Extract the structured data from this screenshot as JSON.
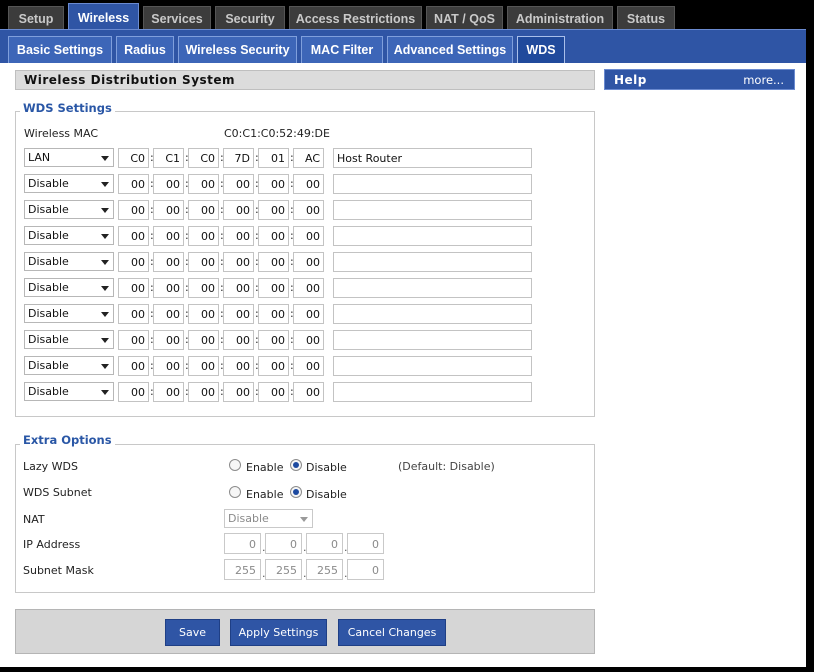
{
  "top_tabs": [
    {
      "label": "Setup",
      "active": false
    },
    {
      "label": "Wireless",
      "active": true
    },
    {
      "label": "Services",
      "active": false
    },
    {
      "label": "Security",
      "active": false
    },
    {
      "label": "Access Restrictions",
      "active": false
    },
    {
      "label": "NAT / QoS",
      "active": false
    },
    {
      "label": "Administration",
      "active": false
    },
    {
      "label": "Status",
      "active": false
    }
  ],
  "sub_tabs": [
    {
      "label": "Basic Settings",
      "active": false
    },
    {
      "label": "Radius",
      "active": false
    },
    {
      "label": "Wireless Security",
      "active": false
    },
    {
      "label": "MAC Filter",
      "active": false
    },
    {
      "label": "Advanced Settings",
      "active": false
    },
    {
      "label": "WDS",
      "active": true
    }
  ],
  "section_title": "Wireless Distribution System",
  "help": {
    "title": "Help",
    "more": "more..."
  },
  "wds_settings": {
    "legend": "WDS Settings",
    "wireless_mac_label": "Wireless MAC",
    "wireless_mac_value": "C0:C1:C0:52:49:DE",
    "rows": [
      {
        "mode": "LAN",
        "mac": [
          "C0",
          "C1",
          "C0",
          "7D",
          "01",
          "AC"
        ],
        "desc": "Host Router"
      },
      {
        "mode": "Disable",
        "mac": [
          "00",
          "00",
          "00",
          "00",
          "00",
          "00"
        ],
        "desc": ""
      },
      {
        "mode": "Disable",
        "mac": [
          "00",
          "00",
          "00",
          "00",
          "00",
          "00"
        ],
        "desc": ""
      },
      {
        "mode": "Disable",
        "mac": [
          "00",
          "00",
          "00",
          "00",
          "00",
          "00"
        ],
        "desc": ""
      },
      {
        "mode": "Disable",
        "mac": [
          "00",
          "00",
          "00",
          "00",
          "00",
          "00"
        ],
        "desc": ""
      },
      {
        "mode": "Disable",
        "mac": [
          "00",
          "00",
          "00",
          "00",
          "00",
          "00"
        ],
        "desc": ""
      },
      {
        "mode": "Disable",
        "mac": [
          "00",
          "00",
          "00",
          "00",
          "00",
          "00"
        ],
        "desc": ""
      },
      {
        "mode": "Disable",
        "mac": [
          "00",
          "00",
          "00",
          "00",
          "00",
          "00"
        ],
        "desc": ""
      },
      {
        "mode": "Disable",
        "mac": [
          "00",
          "00",
          "00",
          "00",
          "00",
          "00"
        ],
        "desc": ""
      },
      {
        "mode": "Disable",
        "mac": [
          "00",
          "00",
          "00",
          "00",
          "00",
          "00"
        ],
        "desc": ""
      }
    ]
  },
  "extra_options": {
    "legend": "Extra Options",
    "lazy_wds": {
      "label": "Lazy WDS",
      "enable": "Enable",
      "disable": "Disable",
      "selected": "Disable",
      "default_note": "(Default: Disable)"
    },
    "wds_subnet": {
      "label": "WDS Subnet",
      "enable": "Enable",
      "disable": "Disable",
      "selected": "Disable"
    },
    "nat": {
      "label": "NAT",
      "value": "Disable"
    },
    "ip_address": {
      "label": "IP Address",
      "octets": [
        "0",
        "0",
        "0",
        "0"
      ]
    },
    "subnet_mask": {
      "label": "Subnet Mask",
      "octets": [
        "255",
        "255",
        "255",
        "0"
      ]
    }
  },
  "buttons": {
    "save": "Save",
    "apply": "Apply Settings",
    "cancel": "Cancel Changes"
  }
}
